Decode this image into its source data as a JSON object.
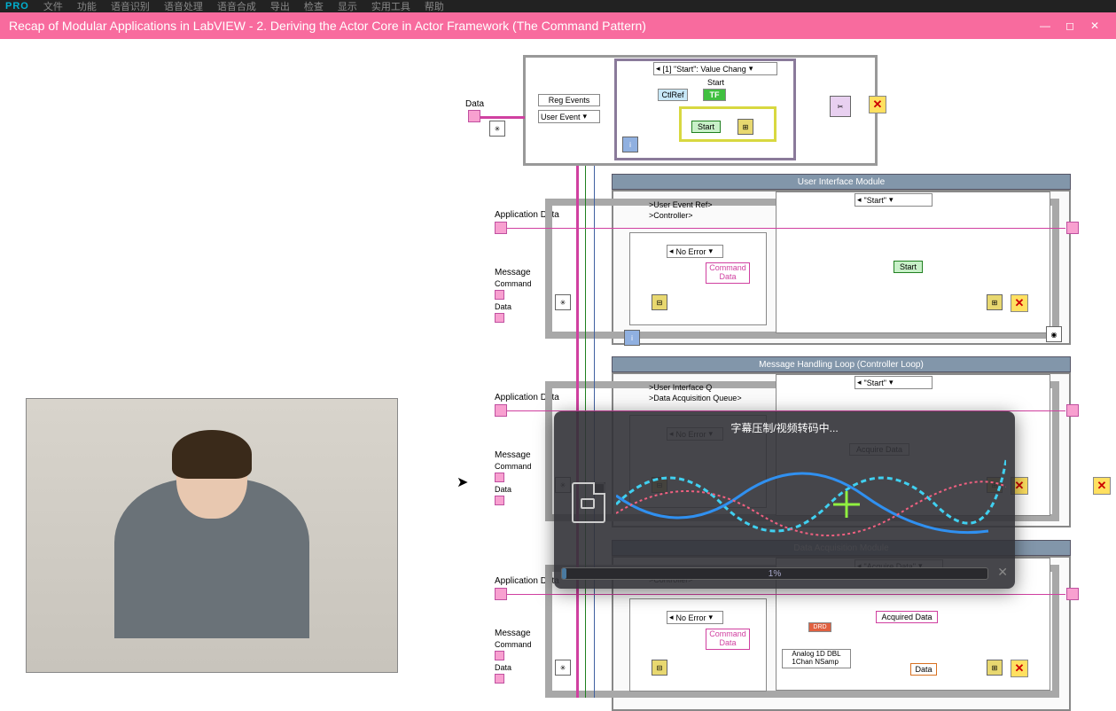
{
  "app": {
    "logo": "PRO"
  },
  "menubar": {
    "items": [
      "文件",
      "功能",
      "语音识别",
      "语音处理",
      "语音合成",
      "导出",
      "检查",
      "显示",
      "实用工具",
      "帮助"
    ]
  },
  "window": {
    "title": "Recap of Modular Applications in LabVIEW - 2. Deriving the Actor Core in Actor Framework (The Command Pattern)",
    "controls": {
      "minimize": "—",
      "maximize": "◻",
      "close": "✕"
    }
  },
  "diagram": {
    "labels": {
      "data": "Data",
      "reg_events": "Reg Events",
      "user_event": "User Event",
      "event_case": "[1] \"Start\": Value Chang",
      "ctlref": "CtlRef",
      "start": "Start",
      "start_btn": "Start",
      "app_data": "Application Data",
      "message": "Message",
      "command": "Command",
      "data_field": "Data",
      "no_error": "No Error",
      "user_event_ref": ">User Event Ref>",
      "controller1": ">Controller>",
      "controller2": ">Controller>",
      "ui_queue": ">User Interface Q",
      "daq_queue": ">Data Acquisition Queue>",
      "command_data": "Command\nData",
      "acquire_data": "Acquire Data",
      "acquired_data": "Acquired Data",
      "analog": "Analog 1D DBL\n1Chan NSamp",
      "data_out": "Data",
      "drd": "DRD"
    },
    "modules": {
      "ui": "User Interface Module",
      "mhl": "Message Handling Loop  (Controller Loop)",
      "daq": "Data Acquisition Module"
    },
    "case_start": "\"Start\"",
    "case_acquire": "\"Acquire Data\""
  },
  "overlay": {
    "message": "字幕压制/视频转码中...",
    "progress_pct": "1%",
    "close": "✕"
  }
}
